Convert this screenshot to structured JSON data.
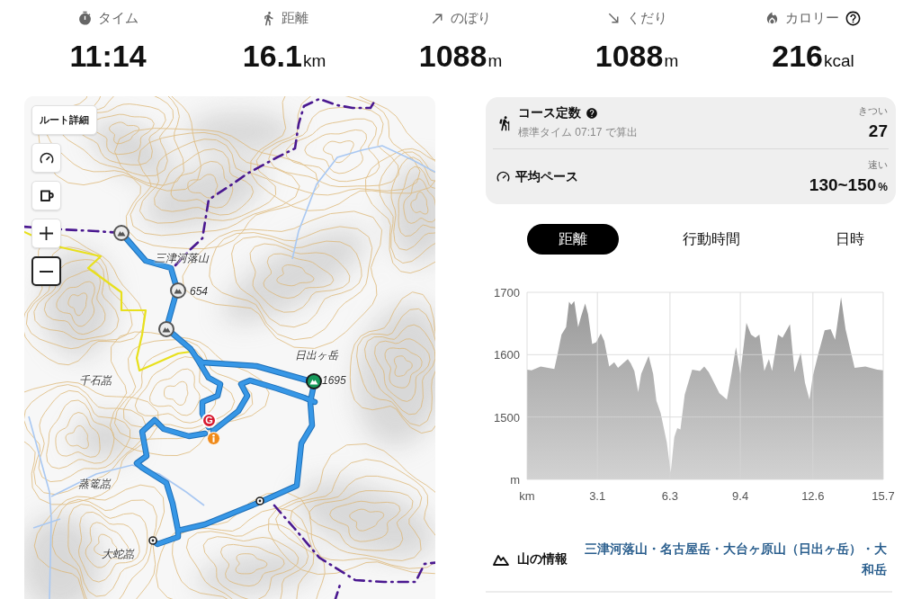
{
  "stats": [
    {
      "kind": "time",
      "label": "タイム",
      "value": "11:14"
    },
    {
      "kind": "distance",
      "label": "距離",
      "value": "16.1",
      "unit": "km"
    },
    {
      "kind": "ascent",
      "label": "のぼり",
      "value": "1088",
      "unit": "m"
    },
    {
      "kind": "descent",
      "label": "くだり",
      "value": "1088",
      "unit": "m"
    },
    {
      "kind": "calories",
      "label": "カロリー",
      "value": "216",
      "unit": "kcal",
      "help": true
    }
  ],
  "map": {
    "controls": [
      {
        "kind": "text",
        "label": "ルート詳細",
        "focused": false
      },
      {
        "kind": "gauge",
        "focused": false
      },
      {
        "kind": "mug",
        "focused": false
      },
      {
        "kind": "zoom_in",
        "focused": false
      },
      {
        "kind": "zoom_out",
        "focused": true
      }
    ],
    "labels": [
      "三津河落山",
      "654",
      "日出ヶ岳",
      "1695",
      "千石嵓",
      "蒸篭嵓",
      "大蛇嵓"
    ],
    "goal_marker": "G"
  },
  "course": [
    {
      "kind": "difficulty",
      "title": "コース定数",
      "help": true,
      "note": "標準タイム 07:17 で算出",
      "rating": "きつい",
      "value": "27"
    },
    {
      "kind": "pace",
      "title": "平均ペース",
      "rating": "速い",
      "value": "130~150",
      "unit": "%"
    }
  ],
  "chart_tabs": [
    {
      "label": "距離",
      "selected": true
    },
    {
      "label": "行動時間",
      "selected": false
    },
    {
      "label": "日時",
      "selected": false
    }
  ],
  "elevation": {
    "chart_data": {
      "type": "area",
      "grid": true,
      "x": [
        0,
        0.2,
        0.6,
        1.2,
        1.33,
        1.52,
        1.72,
        1.85,
        1.95,
        2.08,
        2.25,
        2.38,
        2.56,
        2.69,
        2.87,
        3.05,
        3.25,
        3.4,
        3.62,
        3.84,
        4.01,
        4.44,
        4.57,
        4.73,
        4.9,
        5.03,
        5.36,
        5.56,
        5.7,
        5.89,
        6.16,
        6.33,
        6.49,
        6.62,
        6.76,
        6.95,
        7.28,
        7.62,
        7.81,
        8.01,
        8.48,
        8.81,
        9.01,
        9.21,
        9.4,
        9.67,
        9.87,
        10.07,
        10.24,
        10.46,
        10.66,
        10.8,
        11.06,
        11.26,
        11.59,
        11.79,
        12.06,
        12.25,
        12.45,
        12.59,
        12.85,
        13.12,
        13.38,
        13.58,
        13.84,
        14.04,
        14.44,
        14.91,
        15.44,
        15.7
      ],
      "values": [
        1576,
        1575,
        1581,
        1577,
        1598,
        1632,
        1644,
        1685,
        1680,
        1686,
        1644,
        1661,
        1682,
        1665,
        1617,
        1620,
        1634,
        1622,
        1581,
        1588,
        1579,
        1593,
        1586,
        1574,
        1540,
        1569,
        1598,
        1569,
        1526,
        1506,
        1459,
        1411,
        1468,
        1482,
        1480,
        1536,
        1576,
        1574,
        1581,
        1572,
        1538,
        1528,
        1569,
        1612,
        1569,
        1651,
        1632,
        1627,
        1632,
        1574,
        1593,
        1574,
        1632,
        1627,
        1649,
        1572,
        1603,
        1555,
        1528,
        1565,
        1603,
        1639,
        1641,
        1624,
        1692,
        1641,
        1579,
        1581,
        1576,
        1575
      ],
      "xlim": [
        0,
        15.7
      ],
      "ylim": [
        1400,
        1700
      ],
      "xticks": [
        {
          "value": 0,
          "label": "km"
        },
        3.1,
        6.3,
        9.4,
        12.6,
        15.7
      ],
      "yticks": [
        {
          "value": 1400,
          "label": "m"
        },
        1500,
        1600,
        1700
      ]
    }
  },
  "mountain_info": {
    "label": "山の情報",
    "value": "三津河落山・名古屋岳・大台ヶ原山（日出ヶ岳）・大和岳"
  }
}
